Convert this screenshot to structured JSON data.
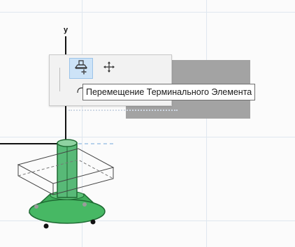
{
  "viewport": {
    "axis_label": "y",
    "tooltip_text": "Перемещение Терминального Элемента"
  },
  "palette": {
    "buttons": [
      {
        "name": "move-terminal-element",
        "icon": "terminal-move-icon",
        "state": "active"
      },
      {
        "name": "move",
        "icon": "move-arrows-icon",
        "state": "normal"
      },
      {
        "name": "rotate",
        "icon": "rotate-icon",
        "state": "normal"
      }
    ]
  },
  "colors": {
    "accent_active": "#cde3f7",
    "model_green": "#3fae5b",
    "grid": "#dfe7ef"
  }
}
